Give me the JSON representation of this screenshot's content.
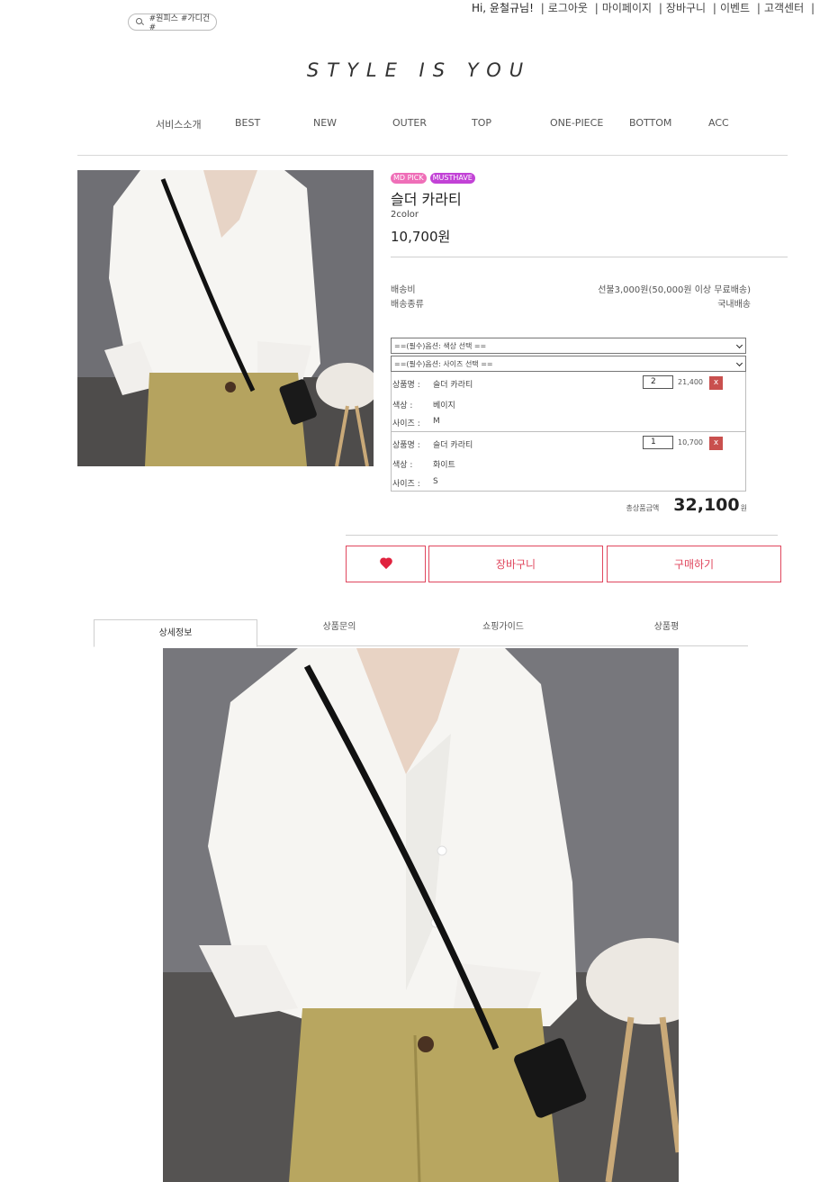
{
  "search": {
    "text": "#원피스 #가디건 #"
  },
  "topbar": {
    "greeting": "Hi, 윤철규님!",
    "links": [
      "로그아웃",
      "마이페이지",
      "장바구니",
      "이벤트",
      "고객센터"
    ]
  },
  "logo": "STYLE IS YOU",
  "nav": [
    "서비스소개",
    "BEST",
    "NEW",
    "OUTER",
    "TOP",
    "ONE-PIECE",
    "BOTTOM",
    "ACC"
  ],
  "product": {
    "badges": [
      "MD PICK",
      "MUSTHAVE"
    ],
    "name": "슬더 카라티",
    "color_count": "2color",
    "price": "10,700원",
    "shipping_fee_label": "배송비",
    "shipping_fee_value": "선불3,000원(50,000원 이상 무료배송)",
    "shipping_type_label": "배송종류",
    "shipping_type_value": "국내배송"
  },
  "options": {
    "color_select": "==(필수)옵션: 색상 선택 ==",
    "size_select": "==(필수)옵션: 사이즈 선택 =="
  },
  "labels": {
    "name": "상품명 :",
    "color": "색상 :",
    "size": "사이즈 :",
    "delete": "x"
  },
  "selected": [
    {
      "name": "슬더 카라티",
      "color": "베이지",
      "size": "M",
      "qty": "2",
      "price": "21,400"
    },
    {
      "name": "슬더 카라티",
      "color": "화이트",
      "size": "S",
      "qty": "1",
      "price": "10,700"
    }
  ],
  "total": {
    "label": "총상품금액",
    "value": "32,100",
    "unit": "원"
  },
  "buttons": {
    "cart": "장바구니",
    "buy": "구매하기"
  },
  "tabs": [
    "상세정보",
    "상품문의",
    "쇼핑가이드",
    "상품평"
  ],
  "colors": {
    "accent": "#e0475e",
    "badge_md": "#ef6fb8",
    "badge_must": "#c242d6",
    "delete": "#c9504e"
  }
}
